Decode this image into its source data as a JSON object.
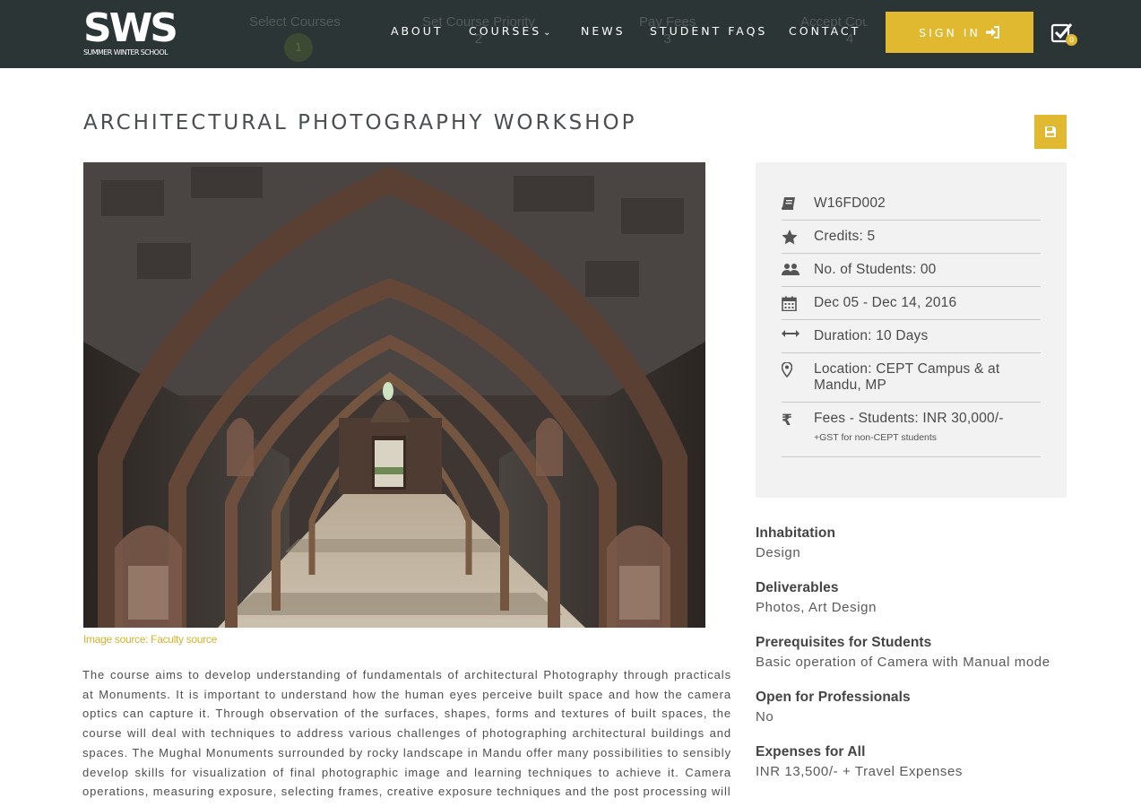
{
  "header": {
    "logo_main": "SWS",
    "logo_sub": "SUMMER WINTER SCHOOL",
    "progress_steps": [
      {
        "label": "Select Courses",
        "number": "1"
      },
      {
        "label": "Set Course Priority",
        "number": "2"
      },
      {
        "label": "Pay Fees",
        "number": "3"
      },
      {
        "label": "Accept Course",
        "number": "4"
      }
    ],
    "nav": {
      "about": "ABOUT",
      "courses": "COURSES",
      "news": "NEWS",
      "faqs": "STUDENT FAQS",
      "contact": "CONTACT"
    },
    "signin_label": "SIGN IN",
    "cart_count": "0"
  },
  "course": {
    "title": "ARCHITECTURAL PHOTOGRAPHY WORKSHOP",
    "image_caption": "Image source: Faculty source",
    "description": "The course aims to develop understanding of fundamentals of architectural Photography through practicals at Monuments. It is important to understand how the human eyes perceive built space and how the camera optics can capture it. Through observation of the surfaces, shapes, forms and textures of built spaces, the course will deal with techniques to address various challenges of photographing architectural buildings and spaces. The Mughal Monuments surrounded by rocky landscape in Mandu offer many possibilities to sensibly develop skills for visualization of final photographic image and learning techniques to achieve it. Camera operations, measuring exposure, selecting frames, creative exposure techniques and the post processing will"
  },
  "info": {
    "code": "W16FD002",
    "credits": "Credits: 5",
    "students": "No. of Students: 00",
    "dates": "Dec 05 - Dec 14, 2016",
    "duration": "Duration: 10 Days",
    "location": "Location: CEPT Campus & at Mandu, MP",
    "fees": "Fees - Students: INR 30,000/-",
    "fees_note": "+GST for non-CEPT students"
  },
  "details": [
    {
      "label": "Inhabitation",
      "value": "Design"
    },
    {
      "label": "Deliverables",
      "value": "Photos, Art Design"
    },
    {
      "label": "Prerequisites for Students",
      "value": "Basic operation of Camera with Manual mode"
    },
    {
      "label": "Open for Professionals",
      "value": "No"
    },
    {
      "label": "Expenses for All",
      "value": "INR 13,500/- + Travel Expenses"
    }
  ],
  "colors": {
    "header_bg": "#2c3536",
    "accent": "#e0b930",
    "panel_bg": "#f2f2f2"
  },
  "icons": {
    "info": [
      "book-icon",
      "star-icon",
      "users-icon",
      "calendar-icon",
      "arrows-horizontal-icon",
      "map-pin-icon",
      "rupee-icon"
    ],
    "signin": "sign-in-icon",
    "cart": "checklist-icon",
    "save": "save-icon"
  }
}
